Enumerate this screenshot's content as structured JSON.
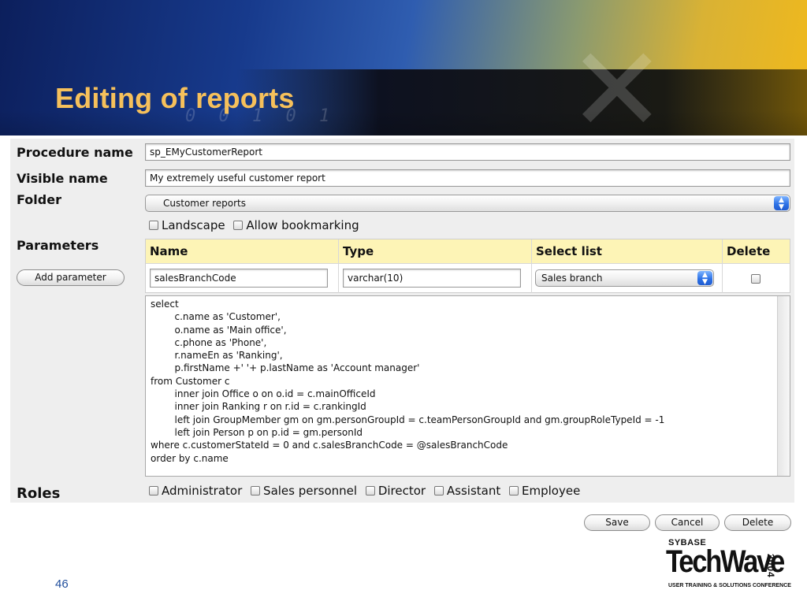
{
  "slide": {
    "title": "Editing of reports",
    "page_number": "46",
    "banner_decoration": "0 0 1 0 1"
  },
  "form": {
    "procedure_name": {
      "label": "Procedure name",
      "value": "sp_EMyCustomerReport"
    },
    "visible_name": {
      "label": "Visible name",
      "value": "My extremely useful customer report"
    },
    "folder": {
      "label": "Folder",
      "selected": "Customer reports"
    },
    "options": {
      "landscape": "Landscape",
      "allow_bookmarking": "Allow bookmarking"
    },
    "parameters": {
      "label": "Parameters",
      "add_button": "Add parameter",
      "columns": [
        "Name",
        "Type",
        "Select list",
        "Delete"
      ],
      "rows": [
        {
          "name": "salesBranchCode",
          "type": "varchar(10)",
          "select_list": "Sales branch"
        }
      ]
    },
    "sql": "select\n        c.name as 'Customer',\n        o.name as 'Main office',\n        c.phone as 'Phone',\n        r.nameEn as 'Ranking',\n        p.firstName +' '+ p.lastName as 'Account manager'\nfrom Customer c\n        inner join Office o on o.id = c.mainOfficeId\n        inner join Ranking r on r.id = c.rankingId\n        left join GroupMember gm on gm.personGroupId = c.teamPersonGroupId and gm.groupRoleTypeId = -1\n        left join Person p on p.id = gm.personId\nwhere c.customerStateId = 0 and c.salesBranchCode = @salesBranchCode\norder by c.name",
    "roles": {
      "label": "Roles",
      "items": [
        "Administrator",
        "Sales personnel",
        "Director",
        "Assistant",
        "Employee"
      ]
    },
    "actions": {
      "save": "Save",
      "cancel": "Cancel",
      "delete": "Delete"
    }
  },
  "logo": {
    "brand": "SYBASE",
    "name": "TechWave",
    "year": "2004",
    "tagline": "USER TRAINING & SOLUTIONS CONFERENCE"
  },
  "colors": {
    "title": "#f6c05b",
    "header_bg": "#fdf4b6",
    "panel_bg": "#eeeeee",
    "select_arrow": "#2e72e6"
  }
}
